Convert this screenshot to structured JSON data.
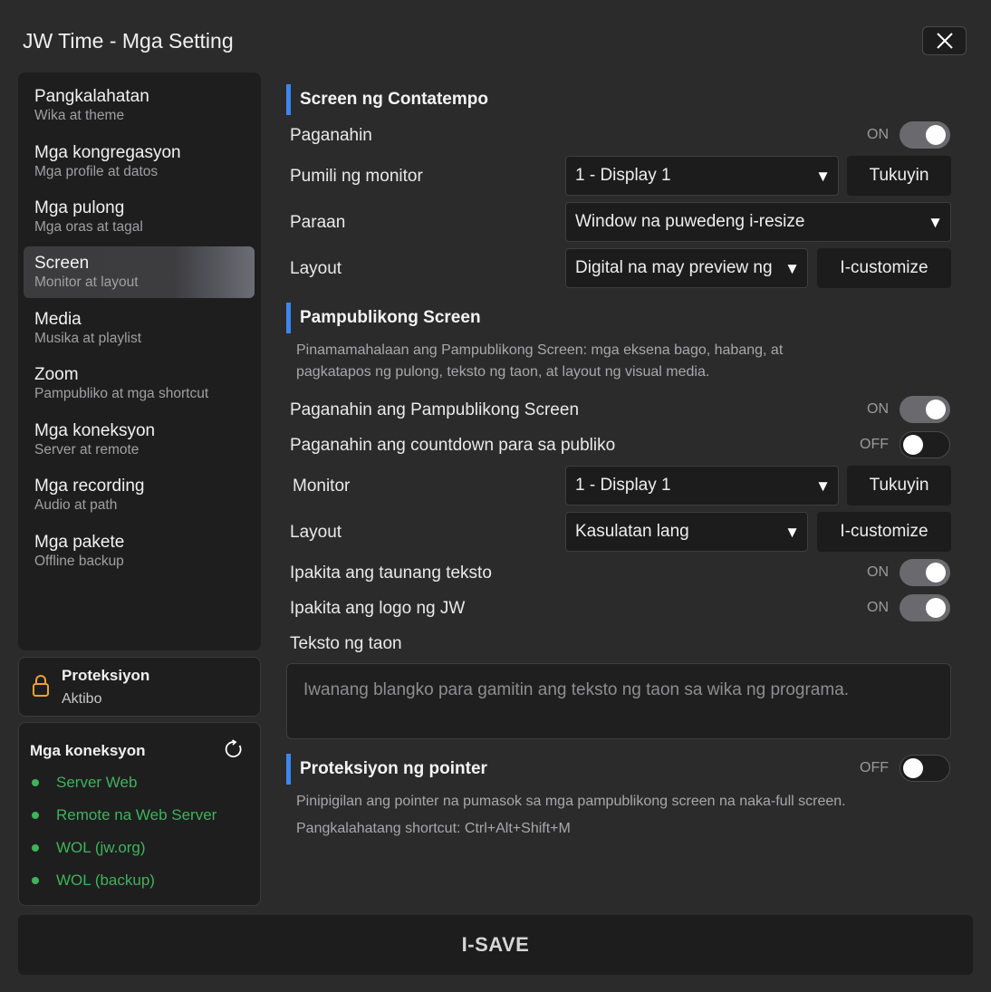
{
  "window": {
    "title": "JW Time - Mga Setting"
  },
  "sidebar": {
    "items": [
      {
        "label": "Pangkalahatan",
        "sub": "Wika at theme"
      },
      {
        "label": "Mga kongregasyon",
        "sub": "Mga profile at datos"
      },
      {
        "label": "Mga pulong",
        "sub": "Mga oras at tagal"
      },
      {
        "label": "Screen",
        "sub": "Monitor at layout",
        "active": true
      },
      {
        "label": "Media",
        "sub": "Musika at playlist"
      },
      {
        "label": "Zoom",
        "sub": "Pampubliko at mga shortcut"
      },
      {
        "label": "Mga koneksyon",
        "sub": "Server at remote"
      },
      {
        "label": "Mga recording",
        "sub": "Audio at path"
      },
      {
        "label": "Mga pakete",
        "sub": "Offline backup"
      }
    ]
  },
  "protection": {
    "title": "Proteksiyon",
    "status": "Aktibo",
    "icon": "lock-icon",
    "color": "#f0a030"
  },
  "connections": {
    "title": "Mga koneksyon",
    "status_color": "#3fb35a",
    "items": [
      "Server Web",
      "Remote na Web Server",
      "WOL (jw.org)",
      "WOL (backup)"
    ]
  },
  "main": {
    "speaker_screen": {
      "heading": "Screen ng Contatempo",
      "enable_label": "Paganahin",
      "enable_state": "ON",
      "monitor_label": "Pumili ng monitor",
      "monitor_value": "1 - Display 1",
      "identify_label": "Tukuyin",
      "mode_label": "Paraan",
      "mode_value": "Window na puwedeng i-resize",
      "layout_label": "Layout",
      "layout_value": "Digital na may preview ng",
      "customize_label": "I-customize"
    },
    "public_screen": {
      "heading": "Pampublikong Screen",
      "description_1": "Pinamamahalaan ang Pampublikong Screen: mga eksena bago, habang, at",
      "description_2": "pagkatapos ng pulong, teksto ng taon, at layout ng visual media.",
      "enable_label": "Paganahin ang Pampublikong Screen",
      "enable_state": "ON",
      "countdown_label": "Paganahin ang countdown para sa publiko",
      "countdown_state": "OFF",
      "monitor_label": "Monitor",
      "monitor_value": "1 - Display 1",
      "identify_label": "Tukuyin",
      "layout_label": "Layout",
      "layout_value": "Kasulatan lang",
      "customize_label": "I-customize",
      "yeartext_label": "Ipakita ang taunang teksto",
      "yeartext_state": "ON",
      "logo_label": "Ipakita ang logo ng JW",
      "logo_state": "ON",
      "yeartext_field_label": "Teksto ng taon",
      "yeartext_placeholder": "Iwanang blangko para gamitin ang teksto ng taon sa wika ng programa."
    },
    "pointer": {
      "heading": "Proteksiyon ng pointer",
      "state": "OFF",
      "description_1": "Pinipigilan ang pointer na pumasok sa mga pampublikong screen na naka-full screen.",
      "description_2": "Pangkalahatang shortcut: Ctrl+Alt+Shift+M"
    }
  },
  "footer": {
    "save_label": "I-SAVE"
  },
  "accent_color": "#3d86f0"
}
